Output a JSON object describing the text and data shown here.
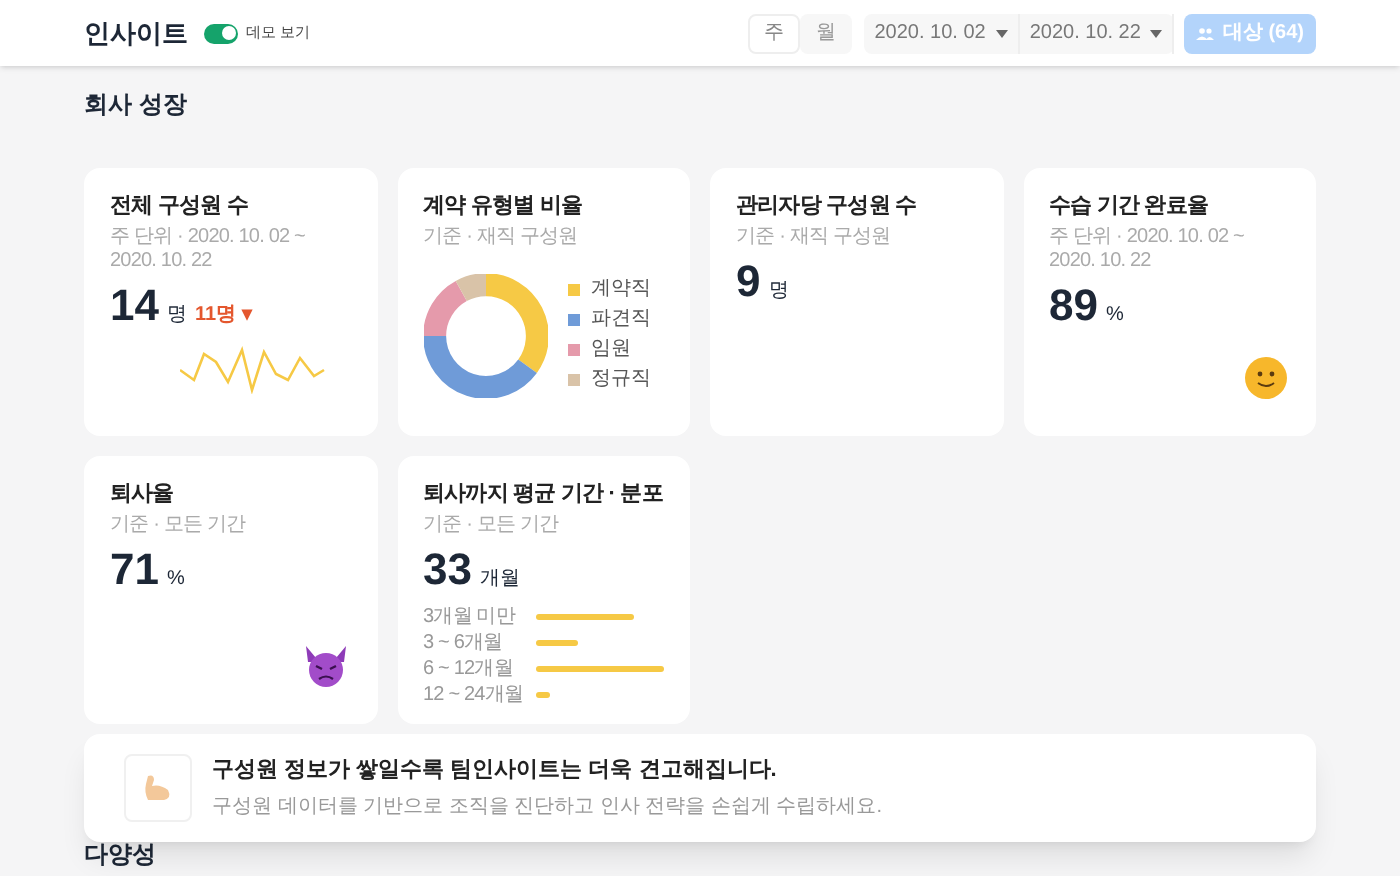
{
  "header": {
    "title": "인사이트",
    "demo_toggle": {
      "label": "데모 보기",
      "on": true
    },
    "period_tabs": [
      {
        "label": "주",
        "selected": true
      },
      {
        "label": "월",
        "selected": false
      }
    ],
    "date_from": "2020. 10. 02",
    "date_to": "2020. 10. 22",
    "target_button": {
      "label": "대상 (64)",
      "disabled": true
    }
  },
  "section_title": "회사 성장",
  "cards": [
    {
      "kind": "trend",
      "title": "전체 구성원 수",
      "subtitle": "주 단위 · 2020. 10. 02 ~ 2020. 10. 22",
      "value": "14",
      "unit": "명",
      "change": "11명 ▾"
    },
    {
      "kind": "donut",
      "title": "계약 유형별 비율",
      "subtitle": "기준 · 재직 구성원",
      "legend": [
        {
          "label": "계약직",
          "color": "#f6c945"
        },
        {
          "label": "파견직",
          "color": "#6f9bd8"
        },
        {
          "label": "임원",
          "color": "#e59aab"
        },
        {
          "label": "정규직",
          "color": "#d9c3a8"
        }
      ]
    },
    {
      "kind": "plain",
      "title": "관리자당 구성원 수",
      "subtitle": "기준 · 재직 구성원",
      "value": "9",
      "unit": "명"
    },
    {
      "kind": "smile",
      "title": "수습 기간 완료율",
      "subtitle": "주 단위 · 2020. 10. 02 ~ 2020. 10. 22",
      "value": "89",
      "unit": "%"
    },
    {
      "kind": "devil",
      "title": "퇴사율",
      "subtitle": "기준 · 모든 기간",
      "value": "71",
      "unit": "%"
    },
    {
      "kind": "bars",
      "title": "퇴사까지 평균 기간 · 분포",
      "subtitle": "기준 · 모든 기간",
      "value": "33",
      "unit": "개월",
      "bars": [
        {
          "label": "3개월 미만"
        },
        {
          "label": "3 ~ 6개월"
        },
        {
          "label": "6 ~ 12개월"
        },
        {
          "label": "12 ~ 24개월"
        }
      ]
    }
  ],
  "notice": {
    "title": "구성원 정보가 쌓일수록 팀인사이트는 더욱 견고해집니다.",
    "text": "구성원 데이터를 기반으로 조직을 진단하고 인사 전략을 손쉽게 수립하세요."
  },
  "next_section_title": "다양성"
}
